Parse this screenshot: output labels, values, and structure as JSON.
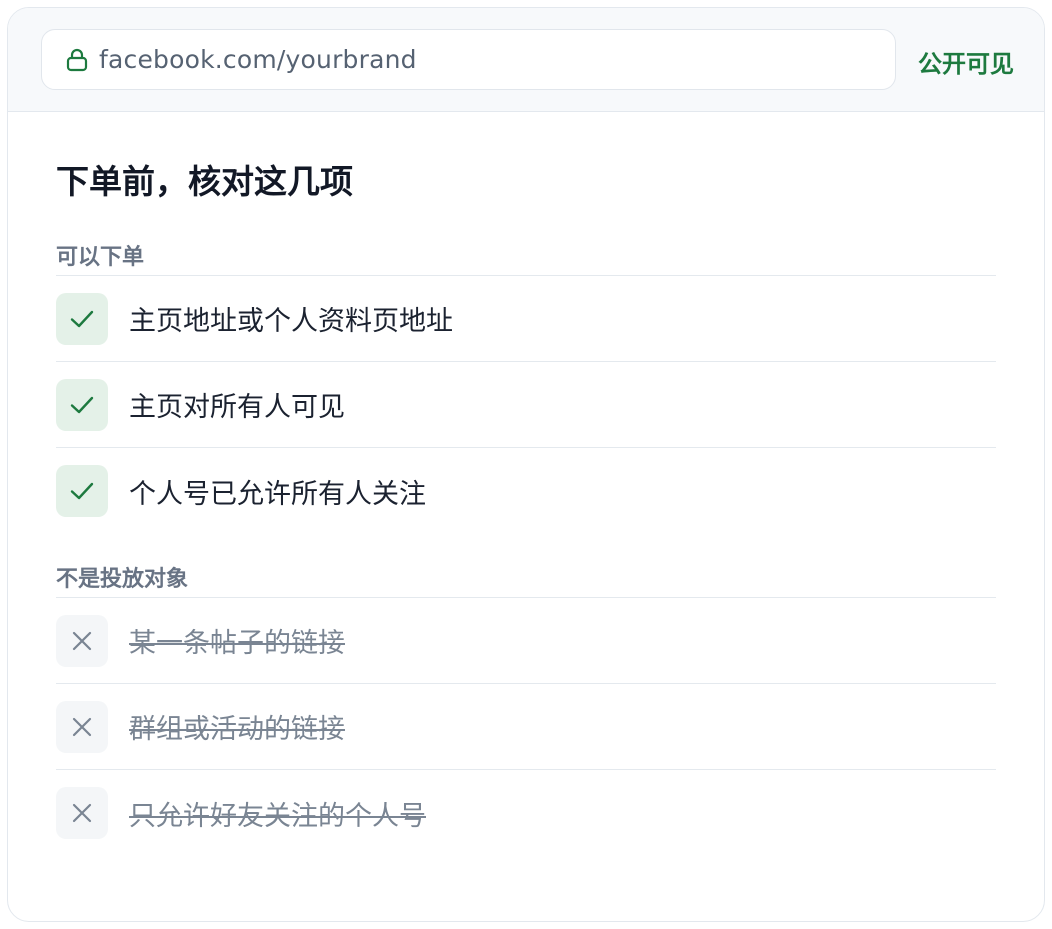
{
  "header": {
    "url": "facebook.com/yourbrand",
    "visibility_label": "公开可见",
    "lock_icon": "lock-icon"
  },
  "checklist": {
    "title": "下单前，核对这几项",
    "accepted": {
      "label": "可以下单",
      "items": [
        "主页地址或个人资料页地址",
        "主页对所有人可见",
        "个人号已允许所有人关注"
      ]
    },
    "rejected": {
      "label": "不是投放对象",
      "items": [
        "某一条帖子的链接",
        "群组或活动的链接",
        "只允许好友关注的个人号"
      ]
    }
  },
  "colors": {
    "accent_green": "#1d7a3f",
    "check_bg": "#e4f1e8",
    "cross_color": "#7a8593"
  }
}
